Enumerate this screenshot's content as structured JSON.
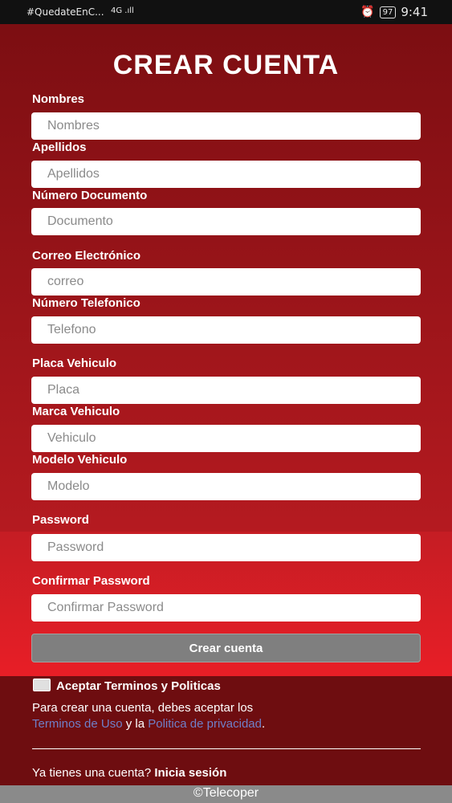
{
  "status_bar": {
    "notification": "#QuedateEnC...",
    "signal": "4G .ıll",
    "battery": "97",
    "time": "9:41"
  },
  "title": "CREAR CUENTA",
  "fields": [
    {
      "label": "Nombres",
      "placeholder": "Nombres"
    },
    {
      "label": "Apellidos",
      "placeholder": "Apellidos"
    },
    {
      "label": "Número Documento",
      "placeholder": "Documento"
    },
    {
      "label": "Correo Electrónico",
      "placeholder": "correo"
    },
    {
      "label": "Número Telefonico",
      "placeholder": "Telefono"
    },
    {
      "label": "Placa Vehiculo",
      "placeholder": "Placa"
    },
    {
      "label": "Marca Vehiculo",
      "placeholder": "Vehiculo"
    },
    {
      "label": "Modelo Vehiculo",
      "placeholder": "Modelo"
    },
    {
      "label": "Password",
      "placeholder": "Password"
    },
    {
      "label": "Confirmar Password",
      "placeholder": "Confirmar Password"
    }
  ],
  "submit_label": "Crear cuenta",
  "terms": {
    "checkbox_label": "Aceptar Terminos y Politicas",
    "notice_text": "Para crear una cuenta, debes aceptar los",
    "terms_link": "Terminos de Uso",
    "connector": "y la",
    "privacy_link": "Politica de privacidad",
    "period": "."
  },
  "login": {
    "prompt": "Ya tienes una cuenta?",
    "link": "Inicia sesión"
  },
  "copyright": "©Telecoper",
  "colors": {
    "background_top": "#7c0e12",
    "background_bottom": "#e81e26",
    "button": "#7f7f7f",
    "link": "#6f7fc7"
  }
}
